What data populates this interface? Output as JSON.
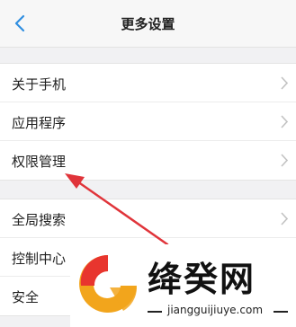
{
  "header": {
    "title": "更多设置",
    "back_icon": "back-chevron-icon"
  },
  "group1": [
    {
      "label": "关于手机"
    },
    {
      "label": "应用程序"
    },
    {
      "label": "权限管理"
    }
  ],
  "group2": [
    {
      "label": "全局搜索"
    },
    {
      "label": "控制中心"
    },
    {
      "label": "安全"
    }
  ],
  "annotation": {
    "color": "#e0343a",
    "points_to": "权限管理"
  },
  "watermark": {
    "brand": "绛癸网",
    "url": "jiangguijiuye.com"
  },
  "colors": {
    "accent": "#2f8ee0",
    "chevron": "#c2c2c2"
  }
}
